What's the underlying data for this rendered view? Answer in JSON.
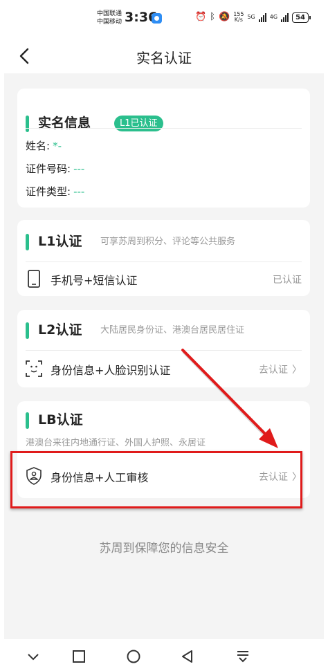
{
  "status_bar": {
    "carrier1": "中国联通",
    "carrier2": "中国移动",
    "time": "3:36",
    "net_speed_value": "155",
    "net_speed_unit": "K/s",
    "net_gen1": "5G",
    "net_gen2": "4G",
    "battery": "54"
  },
  "header": {
    "title": "实名认证"
  },
  "realname_card": {
    "title": "实名信息",
    "level_tag": "L1已认证",
    "rows": [
      {
        "label": "姓名:",
        "value": "*-"
      },
      {
        "label": "证件号码:",
        "value": "---"
      },
      {
        "label": "证件类型:",
        "value": "---"
      }
    ]
  },
  "l1_card": {
    "title": "L1认证",
    "desc": "可享苏周到积分、评论等公共服务",
    "method_label": "手机号+短信认证",
    "method_status": "已认证"
  },
  "l2_card": {
    "title": "L2认证",
    "desc": "大陆居民身份证、港澳台居民居住证",
    "method_label": "身份信息+人脸识别认证",
    "method_status": "去认证"
  },
  "lb_card": {
    "title": "LB认证",
    "desc": "港澳台来往内地通行证、外国人护照、永居证",
    "method_label": "身份信息+人工审核",
    "method_status": "去认证"
  },
  "footer": {
    "note": "苏周到保障您的信息安全"
  },
  "colors": {
    "accent": "#2bbf8d",
    "annotation": "#e01b1b"
  },
  "icons": [
    "back-icon",
    "phone-icon",
    "face-scan-icon",
    "shield-person-icon",
    "chevron-right-icon"
  ]
}
